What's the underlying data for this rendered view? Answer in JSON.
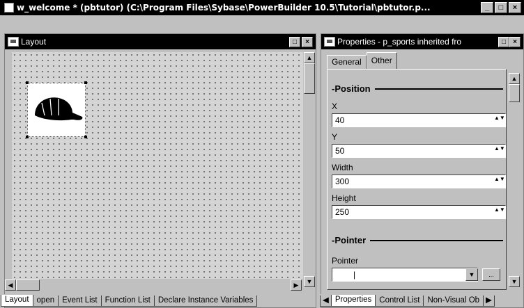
{
  "window": {
    "title": "w_welcome * (pbtutor) (C:\\Program Files\\Sybase\\PowerBuilder 10.5\\Tutorial\\pbtutor.p...",
    "min_label": "_",
    "restore_label": "□",
    "close_label": "×"
  },
  "layout_pane": {
    "title": "Layout",
    "bottom_tabs": [
      {
        "label": "Layout"
      },
      {
        "label": "open"
      },
      {
        "label": "Event List"
      },
      {
        "label": "Function List"
      },
      {
        "label": "Declare Instance Variables"
      }
    ],
    "picture_control": "p_sports"
  },
  "properties_pane": {
    "title": "Properties - p_sports inherited fro",
    "tabs": [
      {
        "label": "General"
      },
      {
        "label": "Other"
      }
    ],
    "active_tab": "Other",
    "sections": {
      "position": "Position",
      "pointer": "Pointer"
    },
    "fields": {
      "x": {
        "label": "X",
        "value": "40"
      },
      "y": {
        "label": "Y",
        "value": "50"
      },
      "width": {
        "label": "Width",
        "value": "300"
      },
      "height": {
        "label": "Height",
        "value": "250"
      },
      "pointer": {
        "label": "Pointer",
        "value": "|"
      }
    },
    "browse_label": "...",
    "bottom_tabs": [
      {
        "label": "Properties"
      },
      {
        "label": "Control List"
      },
      {
        "label": "Non-Visual Ob"
      }
    ]
  },
  "glyphs": {
    "up": "▲",
    "down": "▼",
    "left": "◀",
    "right": "▶",
    "spin": "▲▼",
    "collapse": "-"
  }
}
